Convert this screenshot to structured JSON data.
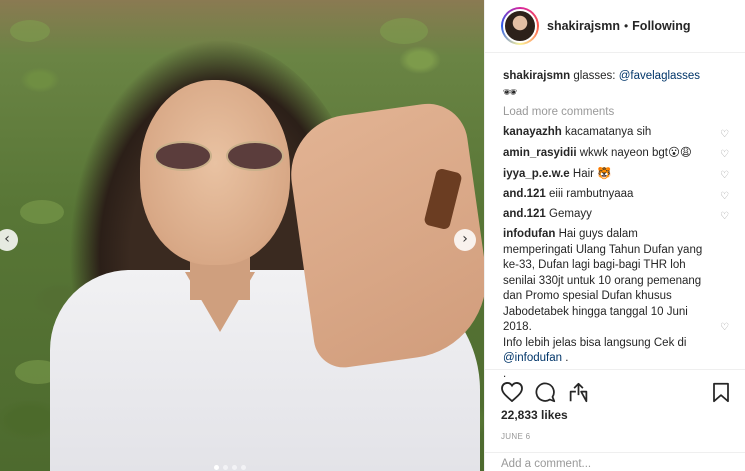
{
  "header": {
    "username": "shakirajsmn",
    "separator": "•",
    "follow_label": "Following"
  },
  "photo": {
    "prev_arrow": "‹",
    "next_arrow": "›",
    "carousel_dots": 4,
    "active_dot": 1
  },
  "comments": {
    "caption": {
      "user": "shakirajsmn",
      "text_before": " glasses: ",
      "mention": "@favelaglasses",
      "emoji": "🕶"
    },
    "load_more_label": "Load more comments",
    "items": [
      {
        "user": "kanayazhh",
        "text": " kacamatanya sih",
        "heart": "♡"
      },
      {
        "user": "amin_rasyidii",
        "text": " wkwk nayeon bgt",
        "emoji": "😮😩",
        "heart": "♡"
      },
      {
        "user": "iyya_p.e.w.e",
        "text": " Hair ",
        "emoji": "🐯",
        "heart": "♡"
      },
      {
        "user": "and.121",
        "text": " eiii rambutnyaaa",
        "heart": "♡"
      },
      {
        "user": "and.121",
        "text": " Gemayy",
        "heart": "♡"
      }
    ],
    "long": {
      "user": "infodufan",
      "text": " Hai guys dalam memperingati Ulang Tahun Dufan yang ke-33, Dufan lagi bagi-bagi THR loh senilai 330jt untuk 10 orang pemenang dan Promo spesial Dufan khusus Jabodetabek hingga tanggal 10 Juni 2018.",
      "text2": "Info lebih jelas bisa langsung Cek di ",
      "mention": "@infodufan",
      "tail": " .",
      "trail": ".",
      "heart": "♡"
    }
  },
  "actions": {
    "likes": "22,833 likes",
    "date": "JUNE 6",
    "add_comment_placeholder": "Add a comment..."
  }
}
